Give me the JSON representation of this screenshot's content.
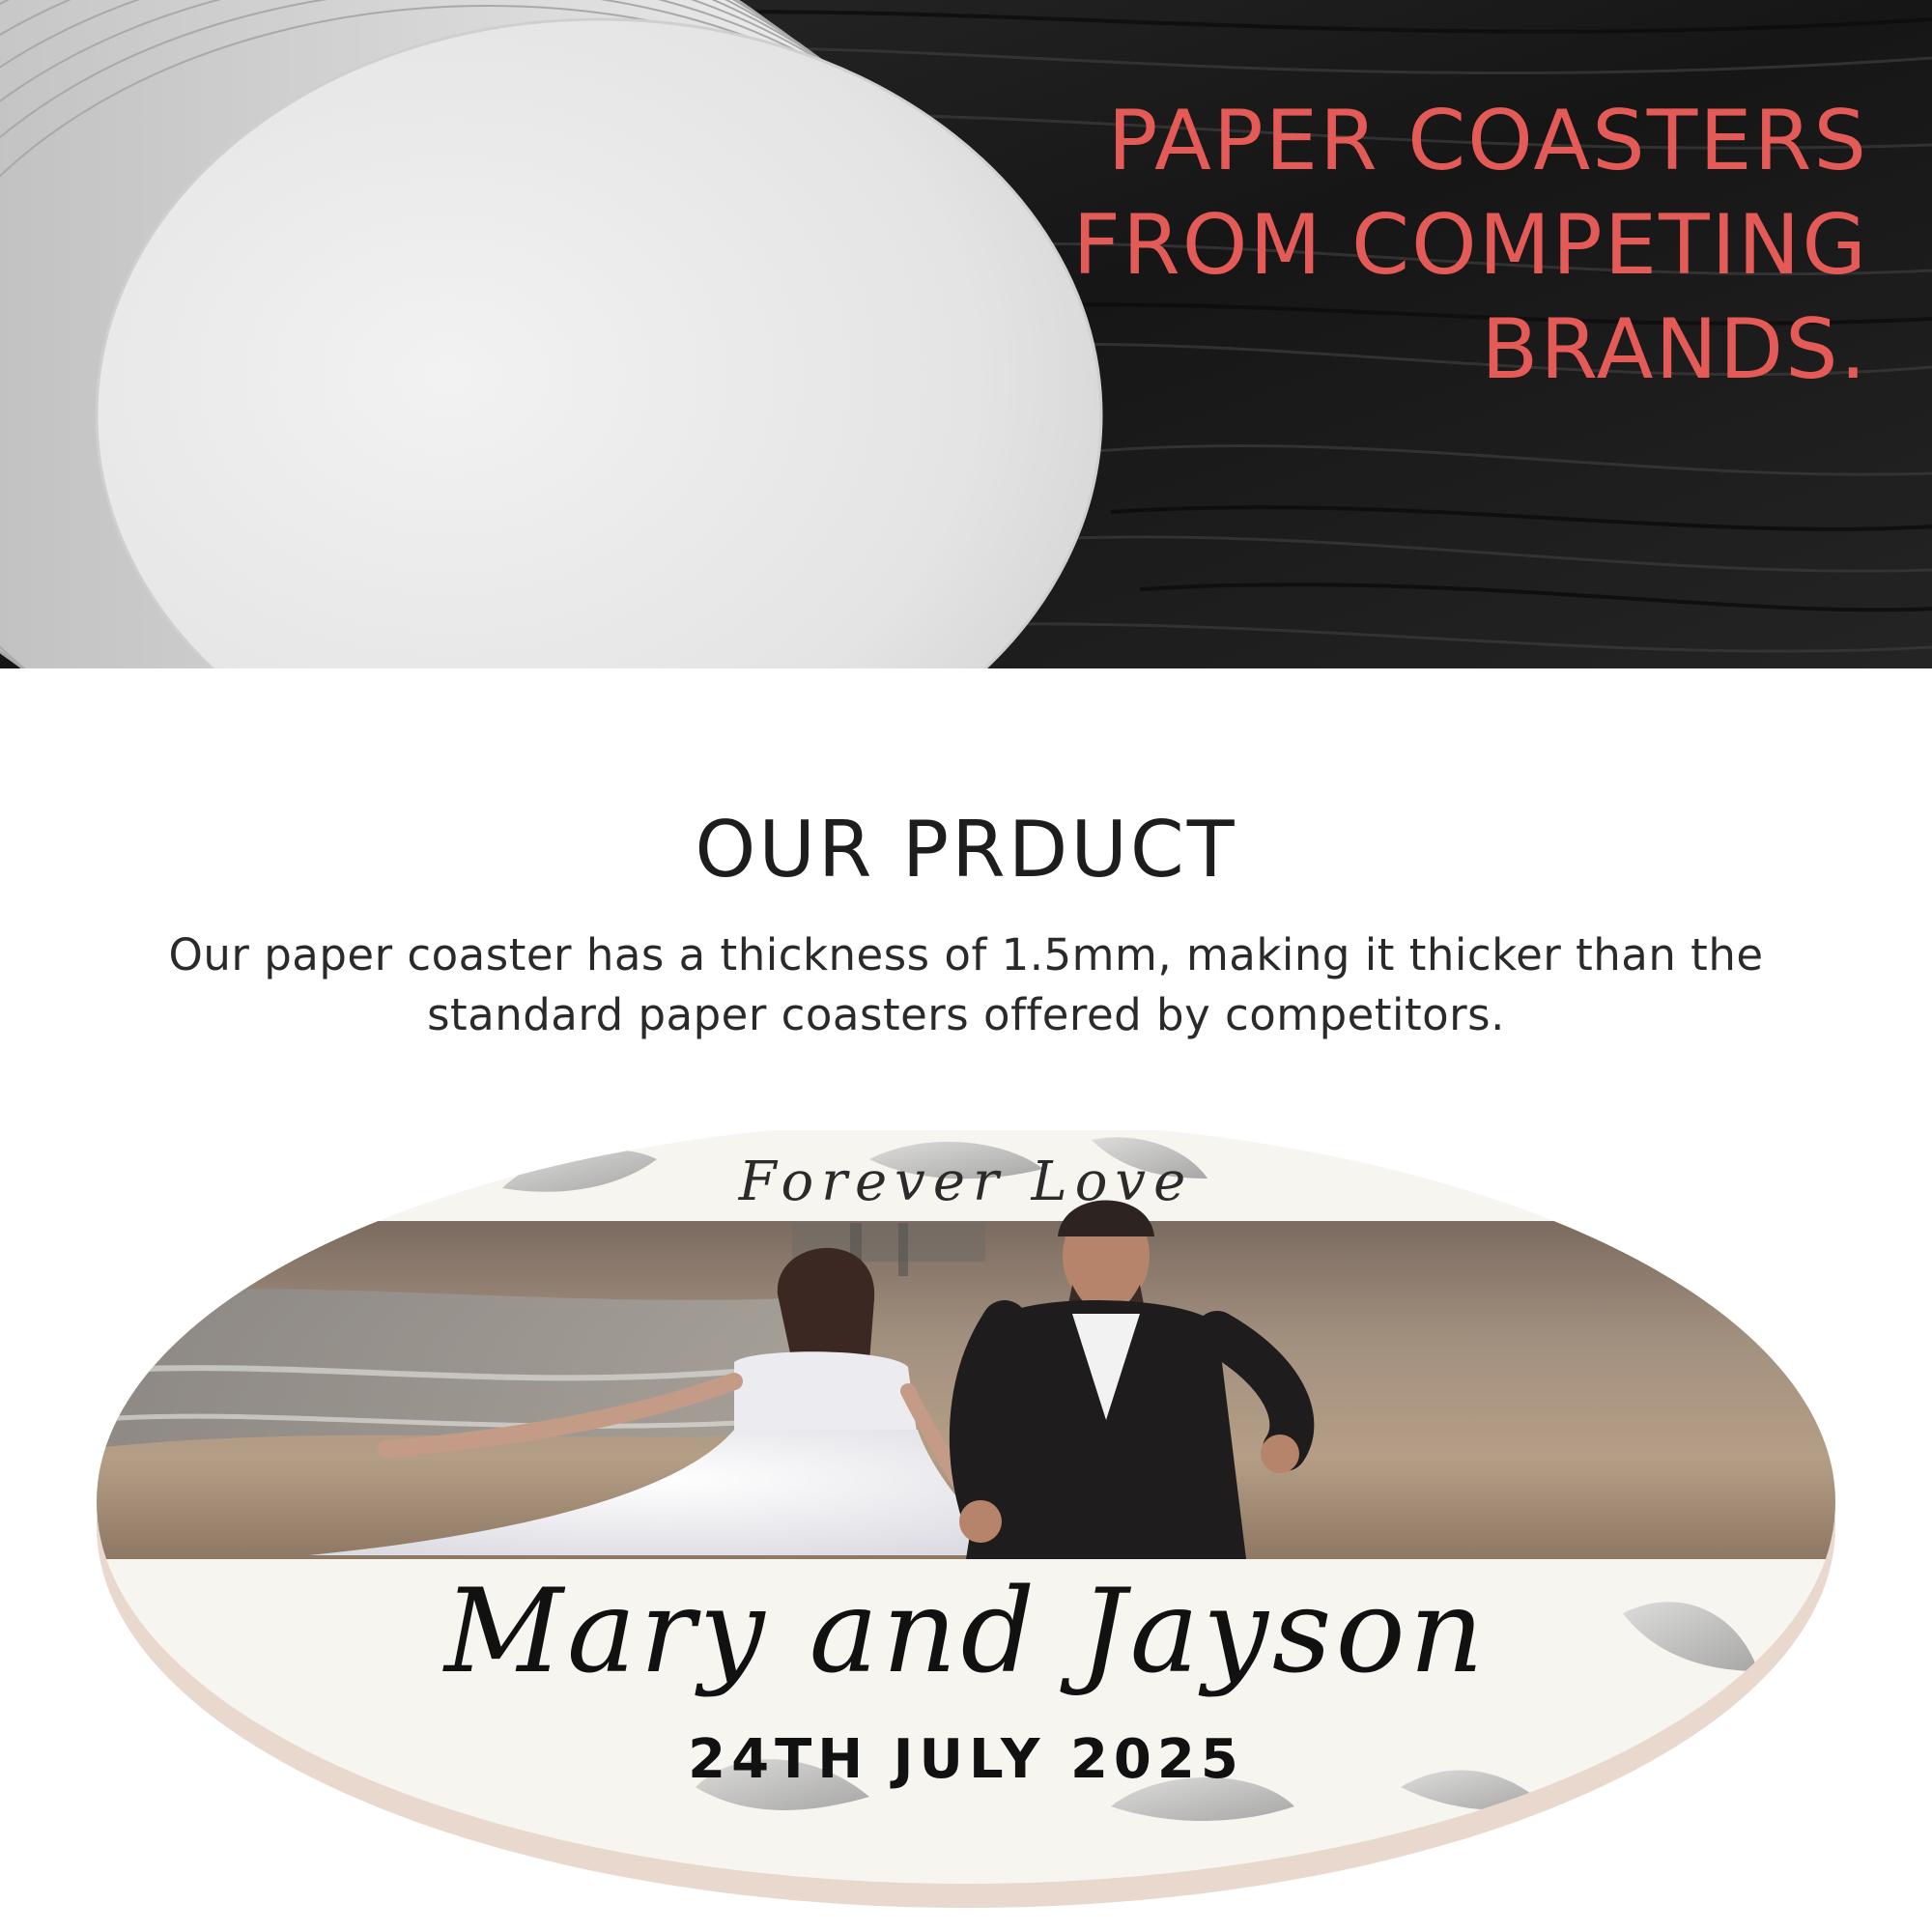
{
  "hero": {
    "title_lines": [
      "PAPER COASTERS",
      "FROM COMPETING",
      "BRANDS."
    ]
  },
  "product": {
    "heading": "OUR PRDUCT",
    "description": "Our paper coaster has a thickness of 1.5mm, making it thicker than the standard paper coasters offered by competitors."
  },
  "coaster": {
    "tagline": "Forever Love",
    "names": "Mary and Jayson",
    "date": "24TH JULY 2025"
  },
  "colors": {
    "hero_title": "#e45a56",
    "heading": "#1d1d1d",
    "body_text": "#2a2a2a",
    "wood_dark": "#1c1c1c",
    "paper": "#e9e9e9",
    "coaster_face": "#f7f5f0",
    "coaster_edge": "#e8d9cf"
  }
}
